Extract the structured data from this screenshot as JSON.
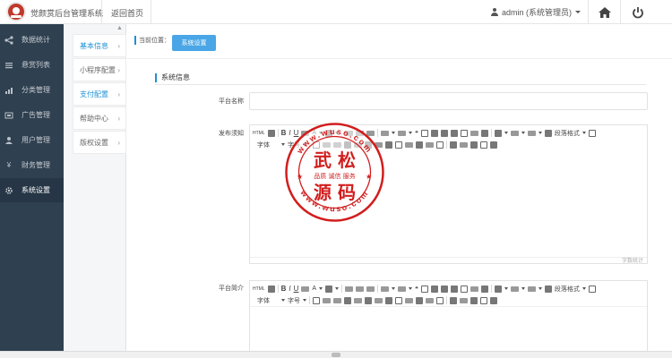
{
  "header": {
    "app_title": "觉颜赏后台管理系统",
    "home_link": "返回首页",
    "user": "admin (系统管理员)"
  },
  "sidebar": {
    "items": [
      {
        "label": "数据统计",
        "icon": "share-icon"
      },
      {
        "label": "悬赏列表",
        "icon": "list-icon"
      },
      {
        "label": "分类管理",
        "icon": "chart-icon"
      },
      {
        "label": "广告管理",
        "icon": "ad-icon"
      },
      {
        "label": "用户管理",
        "icon": "users-icon"
      },
      {
        "label": "财务管理",
        "icon": "yen-icon"
      },
      {
        "label": "系统设置",
        "icon": "gear-icon"
      }
    ]
  },
  "subnav": {
    "items": [
      {
        "label": "基本信息"
      },
      {
        "label": "小程序配置"
      },
      {
        "label": "支付配置"
      },
      {
        "label": "帮助中心"
      },
      {
        "label": "版权设置"
      }
    ]
  },
  "breadcrumb": {
    "label": "当前位置：",
    "button": "系统设置"
  },
  "section": {
    "title": "系统信息"
  },
  "form": {
    "platform_name_label": "平台名称",
    "publish_notice_label": "发布须知",
    "platform_intro_label": "平台简介",
    "word_count": "字数统计"
  },
  "editor": {
    "paragraph_format": "段落格式",
    "font": "字体",
    "font_size": "字号"
  },
  "watermark": {
    "top": "武 松",
    "bottom": "源 码",
    "slogan": "品质 诚信 服务",
    "url": "www.wuso.com",
    "color": "#d21e1e"
  },
  "colors": {
    "sidebar_bg": "#2f4050",
    "accent": "#1e90d6",
    "button": "#4aa6e6"
  }
}
